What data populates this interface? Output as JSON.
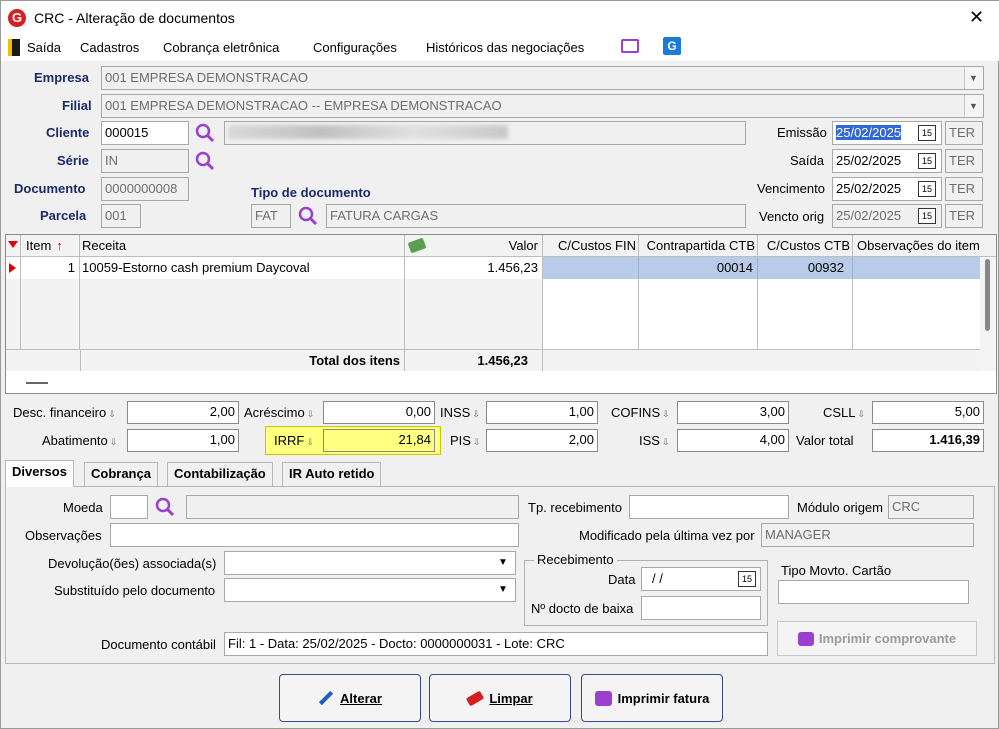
{
  "window": {
    "title": "CRC - Alteração de documentos",
    "close": "✕"
  },
  "menu": [
    "Saída",
    "Cadastros",
    "Cobrança eletrônica",
    "Configurações",
    "Históricos das negociações"
  ],
  "header": {
    "empresa_label": "Empresa",
    "empresa_value": "001 EMPRESA DEMONSTRACAO",
    "filial_label": "Filial",
    "filial_value": "001 EMPRESA DEMONSTRACAO -- EMPRESA DEMONSTRACAO",
    "cliente_label": "Cliente",
    "cliente_value": "000015",
    "serie_label": "Série",
    "serie_value": "IN",
    "documento_label": "Documento",
    "documento_value": "0000000008",
    "parcela_label": "Parcela",
    "parcela_value": "001",
    "tipo_doc_label": "Tipo de documento",
    "tipo_doc_code": "FAT",
    "tipo_doc_desc": "FATURA CARGAS",
    "emissao_label": "Emissão",
    "emissao_value": "25/02/2025",
    "emissao_day": "TER",
    "saida_label": "Saída",
    "saida_value": "25/02/2025",
    "saida_day": "TER",
    "vencimento_label": "Vencimento",
    "vencimento_value": "25/02/2025",
    "vencimento_day": "TER",
    "vencto_orig_label": "Vencto orig",
    "vencto_orig_value": "25/02/2025",
    "vencto_orig_day": "TER"
  },
  "grid": {
    "columns": [
      "Item",
      "Receita",
      "Valor",
      "C/Custos FIN",
      "Contrapartida CTB",
      "C/Custos CTB",
      "Observações do item"
    ],
    "rows": [
      {
        "item": "1",
        "receita": "10059-Estorno cash premium Daycoval",
        "valor": "1.456,23",
        "ccfin": "",
        "contrapartida": "00014",
        "ccctb": "00932",
        "obs": ""
      }
    ],
    "total_label": "Total dos itens",
    "total_value": "1.456,23"
  },
  "totals": {
    "desc_fin_label": "Desc. financeiro",
    "desc_fin": "2,00",
    "acrescimo_label": "Acréscimo",
    "acrescimo": "0,00",
    "inss_label": "INSS",
    "inss": "1,00",
    "cofins_label": "COFINS",
    "cofins": "3,00",
    "csll_label": "CSLL",
    "csll": "5,00",
    "abatimento_label": "Abatimento",
    "abatimento": "1,00",
    "irrf_label": "IRRF",
    "irrf": "21,84",
    "pis_label": "PIS",
    "pis": "2,00",
    "iss_label": "ISS",
    "iss": "4,00",
    "valor_total_label": "Valor total",
    "valor_total": "1.416,39"
  },
  "tabs": [
    "Diversos",
    "Cobrança",
    "Contabilização",
    "IR Auto retido"
  ],
  "diversos": {
    "moeda_label": "Moeda",
    "obs_label": "Observações",
    "devolucao_label": "Devolução(ões) associada(s)",
    "substituido_label": "Substituído pelo documento",
    "tp_receb_label": "Tp. recebimento",
    "modulo_label": "Módulo origem",
    "modulo_value": "CRC",
    "modificado_label": "Modificado pela última vez por",
    "modificado_value": "MANAGER",
    "recebimento_group": "Recebimento",
    "data_label": "Data",
    "data_value": "/ /",
    "ndocto_label": "Nº docto de baixa",
    "tipo_movto_label": "Tipo Movto. Cartão",
    "imprimir_comprovante": "Imprimir comprovante",
    "doc_contabil_label": "Documento contábil",
    "doc_contabil_value": "Fil: 1 - Data: 25/02/2025 - Docto: 0000000031 - Lote: CRC"
  },
  "buttons": {
    "alterar": "Alterar",
    "limpar": "Limpar",
    "imprimir_fatura": "Imprimir fatura"
  },
  "colors": {
    "label_blue": "#1a2a6c",
    "selection": "#b8cbe8",
    "irrf_bg": "#ffff80",
    "accent_purple": "#9a3fd0"
  }
}
